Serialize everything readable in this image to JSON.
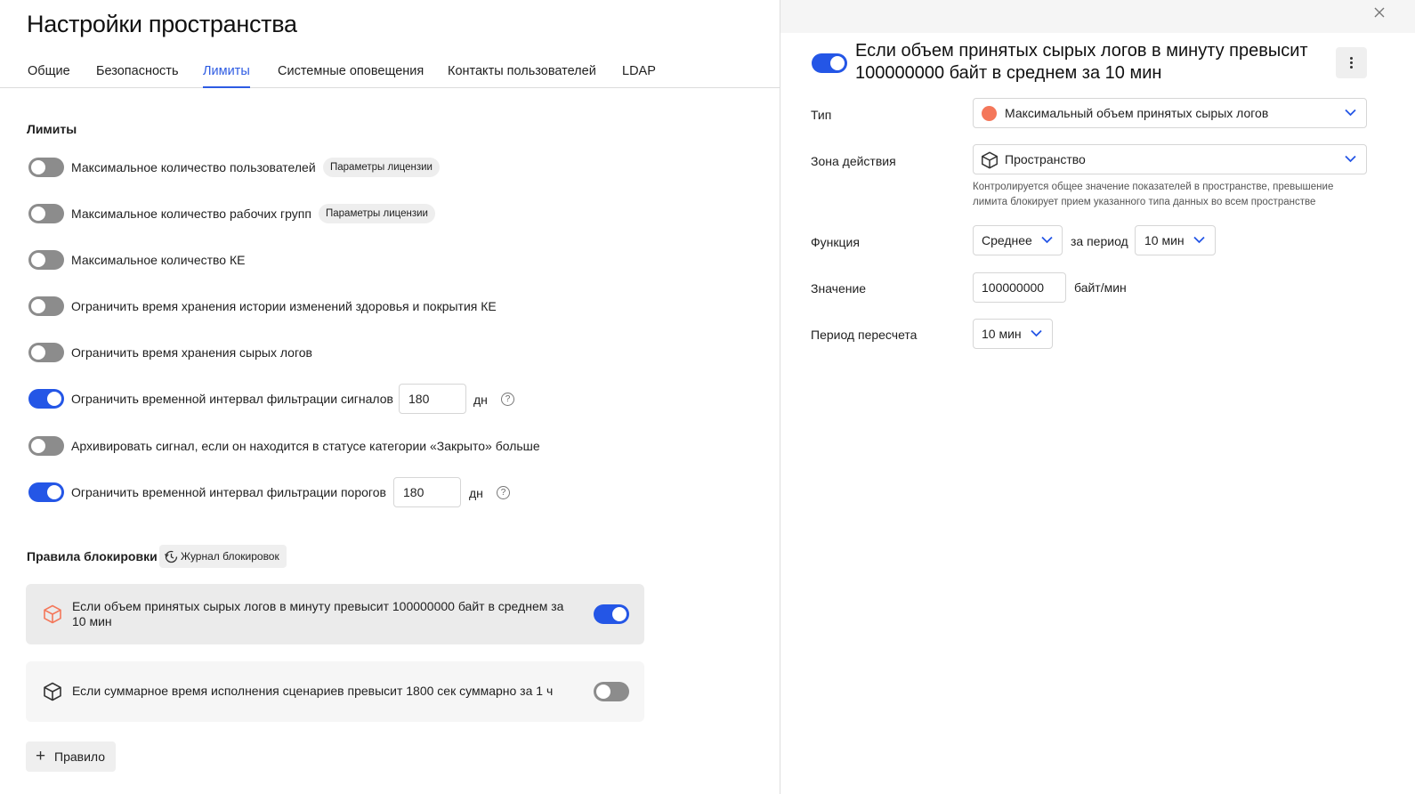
{
  "page": {
    "title": "Настройки пространства",
    "tabs": [
      {
        "label": "Общие",
        "active": false
      },
      {
        "label": "Безопасность",
        "active": false
      },
      {
        "label": "Лимиты",
        "active": true
      },
      {
        "label": "Системные оповещения",
        "active": false
      },
      {
        "label": "Контакты пользователей",
        "active": false
      },
      {
        "label": "LDAP",
        "active": false
      }
    ]
  },
  "limits": {
    "title": "Лимиты",
    "items": [
      {
        "label": "Максимальное количество пользователей",
        "enabled": false,
        "badge": "Параметры лицензии"
      },
      {
        "label": "Максимальное количество рабочих групп",
        "enabled": false,
        "badge": "Параметры лицензии"
      },
      {
        "label": "Максимальное количество КЕ",
        "enabled": false
      },
      {
        "label": "Ограничить время хранения истории изменений здоровья и покрытия КЕ",
        "enabled": false
      },
      {
        "label": "Ограничить время хранения сырых логов",
        "enabled": false
      },
      {
        "label": "Ограничить временной интервал фильтрации сигналов",
        "enabled": true,
        "value": "180",
        "unit": "дн",
        "help": "?"
      },
      {
        "label": "Архивировать сигнал, если он находится в статусе категории «Закрыто» больше",
        "enabled": false
      },
      {
        "label": "Ограничить временной интервал фильтрации порогов",
        "enabled": true,
        "value": "180",
        "unit": "дн",
        "help": "?"
      }
    ]
  },
  "blocking": {
    "title": "Правила блокировки",
    "journal_label": "Журнал блокировок",
    "rules": [
      {
        "text": "Если объем принятых сырых логов в минуту превысит 100000000 байт в среднем за 10 мин",
        "enabled": true,
        "selected": true,
        "icon": "cube-icon",
        "icon_color": "#f4775a"
      },
      {
        "text": "Если суммарное время исполнения сценариев превысит 1800 сек суммарно за 1 ч",
        "enabled": false,
        "selected": false,
        "icon": "cube-icon",
        "icon_color": "#333333"
      }
    ],
    "add_label": "Правило"
  },
  "drawer": {
    "enabled": true,
    "title": "Если объем принятых сырых логов в минуту превысит 100000000 байт в среднем за 10 мин",
    "type_label": "Тип",
    "type_value": "Максимальный объем принятых сырых логов",
    "type_dot_color": "#f4775a",
    "zone_label": "Зона действия",
    "zone_value": "Пространство",
    "zone_hint": "Контролируется общее значение показателей в пространстве, превышение лимита блокирует прием указанного типа данных во всем пространстве",
    "function_label": "Функция",
    "function_value": "Среднее",
    "period_label": "за период",
    "period_value": "10 мин",
    "value_label": "Значение",
    "value": "100000000",
    "value_unit": "байт/мин",
    "recalc_label": "Период пересчета",
    "recalc_value": "10 мин"
  },
  "colors": {
    "accent": "#2456e6",
    "toggle_off": "#8c8c8c",
    "danger_icon": "#f4775a"
  }
}
